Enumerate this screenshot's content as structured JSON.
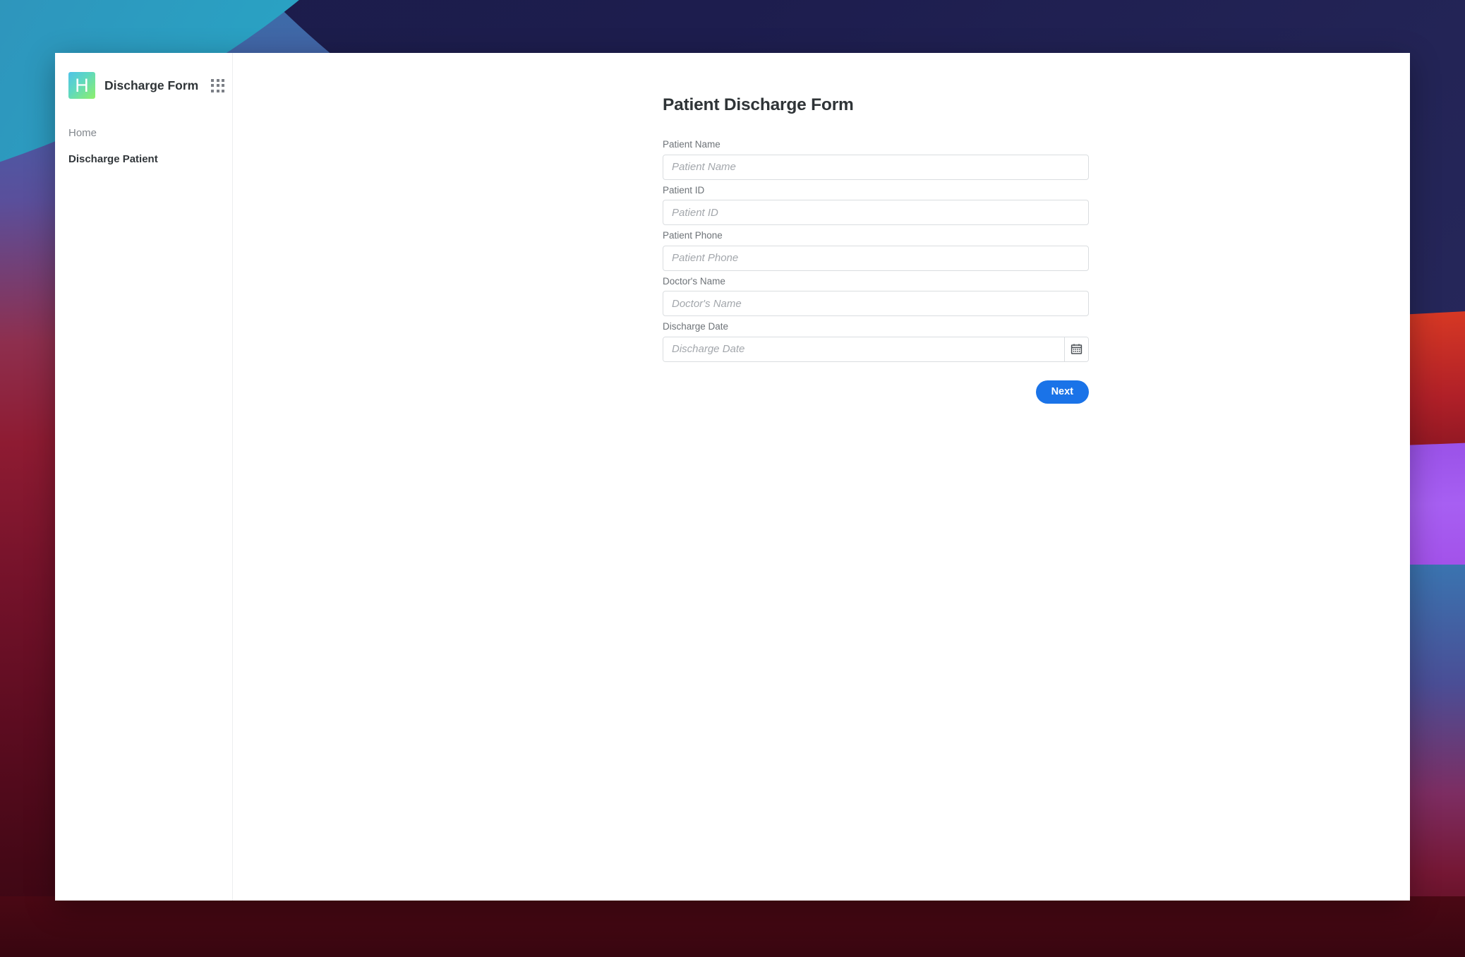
{
  "sidebar": {
    "brand": {
      "logo_letter": "H",
      "logo_gradient_from": "#4fc3e8",
      "logo_gradient_to": "#8ef06a",
      "title": "Discharge Form",
      "apps_icon": "apps-grid-icon"
    },
    "items": [
      {
        "label": "Home",
        "active": false
      },
      {
        "label": "Discharge Patient",
        "active": true
      }
    ]
  },
  "main": {
    "page_title": "Patient Discharge Form",
    "fields": [
      {
        "label": "Patient Name",
        "placeholder": "Patient Name",
        "value": "",
        "type": "text"
      },
      {
        "label": "Patient ID",
        "placeholder": "Patient ID",
        "value": "",
        "type": "text"
      },
      {
        "label": "Patient Phone",
        "placeholder": "Patient Phone",
        "value": "",
        "type": "text"
      },
      {
        "label": "Doctor's Name",
        "placeholder": "Doctor's Name",
        "value": "",
        "type": "text"
      },
      {
        "label": "Discharge Date",
        "placeholder": "Discharge Date",
        "value": "",
        "type": "date",
        "icon": "calendar-icon"
      }
    ],
    "next_button": {
      "label": "Next",
      "color": "#1a73e8",
      "text_color": "#ffffff"
    }
  },
  "colors": {
    "accent": "#1a73e8",
    "label_text": "#6e7378",
    "placeholder_text": "#a3a7ac",
    "heading_text": "#2f3437",
    "input_border": "#dadde0",
    "sidebar_divider": "#eceef0"
  }
}
